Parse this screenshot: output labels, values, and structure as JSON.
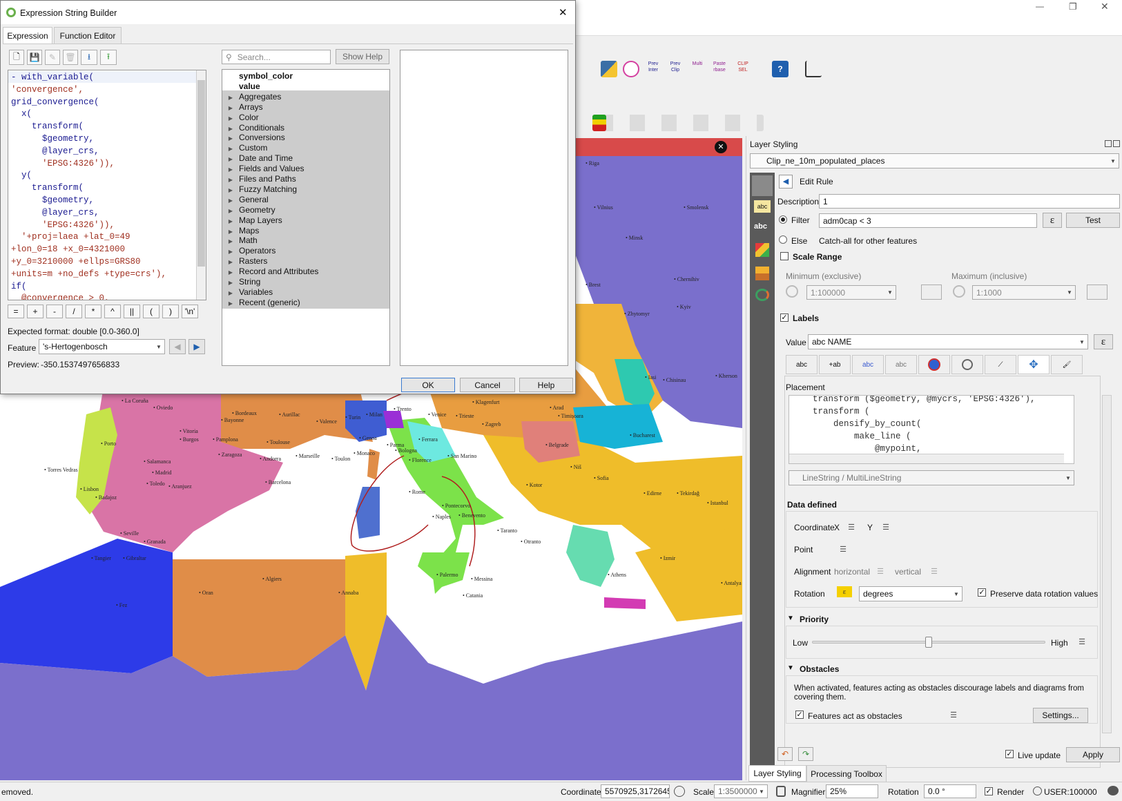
{
  "qgis": {
    "win_controls": {
      "minimize": "—",
      "restore": "❐",
      "close": "✕"
    },
    "map_labels": [
      {
        "t": "Riga"
      },
      {
        "t": "Vilnius"
      },
      {
        "t": "Minsk"
      },
      {
        "t": "Smolensk"
      },
      {
        "t": "Chernihiv"
      },
      {
        "t": "Brest"
      },
      {
        "t": "Zhytomyr"
      },
      {
        "t": "Kyiv"
      },
      {
        "t": "Iasi"
      },
      {
        "t": "Chisinau"
      },
      {
        "t": "Kherson"
      },
      {
        "t": "La Coruña"
      },
      {
        "t": "Oviedo"
      },
      {
        "t": "Bayonne"
      },
      {
        "t": "Bordeaux"
      },
      {
        "t": "Aurillac"
      },
      {
        "t": "Valence"
      },
      {
        "t": "Turin"
      },
      {
        "t": "Milan"
      },
      {
        "t": "Trento"
      },
      {
        "t": "Venice"
      },
      {
        "t": "Trieste"
      },
      {
        "t": "Klagenfurt"
      },
      {
        "t": "Zagreb"
      },
      {
        "t": "Arad"
      },
      {
        "t": "Timișoara"
      },
      {
        "t": "Vitoria"
      },
      {
        "t": "Burgos"
      },
      {
        "t": "Pamplona"
      },
      {
        "t": "Toulouse"
      },
      {
        "t": "Andorra"
      },
      {
        "t": "Marseille"
      },
      {
        "t": "Toulon"
      },
      {
        "t": "Monaco"
      },
      {
        "t": "Genoa"
      },
      {
        "t": "Parma"
      },
      {
        "t": "Ferrara"
      },
      {
        "t": "Bologna"
      },
      {
        "t": "Florence"
      },
      {
        "t": "San Marino"
      },
      {
        "t": "Belgrade"
      },
      {
        "t": "Bucharest"
      },
      {
        "t": "Porto"
      },
      {
        "t": "Salamanca"
      },
      {
        "t": "Zaragoza"
      },
      {
        "t": "Barcelona"
      },
      {
        "t": "Torres Vedras"
      },
      {
        "t": "Lisbon"
      },
      {
        "t": "Madrid"
      },
      {
        "t": "Toledo"
      },
      {
        "t": "Aranjuez"
      },
      {
        "t": "Badajoz"
      },
      {
        "t": "Seville"
      },
      {
        "t": "Granada"
      },
      {
        "t": "Tangier"
      },
      {
        "t": "Gibraltar"
      },
      {
        "t": "Rome"
      },
      {
        "t": "Pontecorvo"
      },
      {
        "t": "Benevento"
      },
      {
        "t": "Naples"
      },
      {
        "t": "Taranto"
      },
      {
        "t": "Otranto"
      },
      {
        "t": "Kotor"
      },
      {
        "t": "Niš"
      },
      {
        "t": "Sofia"
      },
      {
        "t": "Edirne"
      },
      {
        "t": "Tekirdağ"
      },
      {
        "t": "Istanbul"
      },
      {
        "t": "Palermo"
      },
      {
        "t": "Messina"
      },
      {
        "t": "Catania"
      },
      {
        "t": "Athens"
      },
      {
        "t": "Izmir"
      },
      {
        "t": "Antalya"
      },
      {
        "t": "Oran"
      },
      {
        "t": "Algiers"
      },
      {
        "t": "Annaba"
      },
      {
        "t": "Fez"
      }
    ],
    "toolbar_icons": [
      "python-icon",
      "plugin-icon",
      "prev-inter-icon",
      "prev-clip-icon",
      "multi-icon",
      "paste-rebase-icon",
      "clip-sel-icon",
      "help-icon",
      "vertex-tool-icon"
    ],
    "toolbar_icon_labels": {
      "prev_inter": "Prev Inter",
      "prev_clip": "Prev Clip",
      "multi": "Multi",
      "paste": "Paste rbase",
      "clip": "CLIP SEL"
    },
    "help_icon_glyph": "?",
    "map_close_glyph": "✕"
  },
  "dialog": {
    "title": "Expression String Builder",
    "close_glyph": "✕",
    "tabs": [
      {
        "label": "Expression",
        "active": true
      },
      {
        "label": "Function Editor",
        "active": false
      }
    ],
    "toolbar_icons": [
      "new-file-icon",
      "save-icon",
      "edit-icon",
      "delete-icon",
      "import-icon",
      "export-icon"
    ],
    "code_lines": [
      "- with_variable(",
      "'convergence',",
      "grid_convergence(",
      "  x(",
      "    transform(",
      "      $geometry,",
      "      @layer_crs,",
      "      'EPSG:4326')),",
      "  y(",
      "    transform(",
      "      $geometry,",
      "      @layer_crs,",
      "      'EPSG:4326')),",
      "  '+proj=laea +lat_0=49",
      "+lon_0=18 +x_0=4321000",
      "+y_0=3210000 +ellps=GRS80",
      "+units=m +no_defs +type=crs'),",
      "if(",
      "  @convergence > 0,"
    ],
    "operators": [
      "=",
      "+",
      "-",
      "/",
      "*",
      "^",
      "||",
      "(",
      ")",
      "'\\n'"
    ],
    "expected_format": "Expected format:  double [0.0-360.0]",
    "feature_label": "Feature",
    "feature_value": "'s-Hertogenbosch",
    "preview_label": "Preview:",
    "preview_value": "-350.1537497656833",
    "search_placeholder": "Search...",
    "show_help": "Show Help",
    "tree_bold": [
      "symbol_color",
      "value"
    ],
    "tree_groups": [
      "Aggregates",
      "Arrays",
      "Color",
      "Conditionals",
      "Conversions",
      "Custom",
      "Date and Time",
      "Fields and Values",
      "Files and Paths",
      "Fuzzy Matching",
      "General",
      "Geometry",
      "Map Layers",
      "Maps",
      "Math",
      "Operators",
      "Rasters",
      "Record and Attributes",
      "String",
      "Variables",
      "Recent (generic)"
    ],
    "ok": "OK",
    "cancel": "Cancel",
    "help": "Help"
  },
  "styling": {
    "title": "Layer Styling",
    "layer": "Clip_ne_10m_populated_places",
    "edit_rule": "Edit Rule",
    "description_label": "Description",
    "description_value": "1",
    "filter_label": "Filter",
    "filter_value": "adm0cap < 3",
    "test": "Test",
    "else_label": "Else",
    "else_desc": "Catch-all for other features",
    "scale_range": "Scale Range",
    "min_label": "Minimum (exclusive)",
    "max_label": "Maximum (inclusive)",
    "min_value": "1:100000",
    "max_value": "1:1000",
    "labels": "Labels",
    "value_label": "Value",
    "value_field": "abc NAME",
    "placement": "Placement",
    "placement_code": [
      "    transform ($geometry, @mycrs, 'EPSG:4326'),",
      "    transform (",
      "        densify_by_count(",
      "            make_line (",
      "                @mypoint,"
    ],
    "geometry_type": "LineString / MultiLineString",
    "data_defined": "Data defined",
    "coordinate": "Coordinate",
    "x": "X",
    "y": "Y",
    "point": "Point",
    "alignment": "Alignment",
    "horizontal": "horizontal",
    "vertical": "vertical",
    "rotation": "Rotation",
    "rotation_unit": "degrees",
    "preserve": "Preserve data rotation values",
    "priority": "Priority",
    "low": "Low",
    "high": "High",
    "priority_value": 0.5,
    "obstacles": "Obstacles",
    "obstacles_desc": "When activated, features acting as obstacles discourage labels and diagrams from covering them.",
    "features_obstacles": "Features act as obstacles",
    "settings": "Settings...",
    "live_update": "Live update",
    "apply": "Apply",
    "dock_tabs": [
      "Layer Styling",
      "Processing Toolbox"
    ],
    "tab_texts": {
      "abc": "abc",
      "abc2": "+ab",
      "abc3": "abc",
      "abc4": "abc"
    },
    "side_abc": "abc"
  },
  "status": {
    "message": "emoved.",
    "coordinate_label": "Coordinate",
    "coordinate_value": "5570925,3172645",
    "scale_label": "Scale",
    "scale_value": "1:3500000",
    "magnifier_label": "Magnifier",
    "magnifier_value": "25%",
    "rotation_label": "Rotation",
    "rotation_value": "0.0 °",
    "render_label": "Render",
    "crs": "USER:100000"
  }
}
